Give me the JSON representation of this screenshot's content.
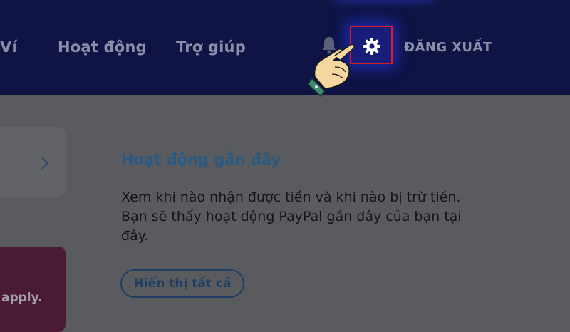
{
  "header": {
    "nav": [
      "Ví",
      "Hoạt động",
      "Trợ giúp"
    ],
    "logout_label": "ĐĂNG XUẤT",
    "icons": {
      "notifications": "bell-icon",
      "settings": "gear-icon",
      "pointer": "pointing-hand-icon"
    },
    "highlight_color": "#e01a22"
  },
  "left_panel": {
    "promo_text": "apply."
  },
  "activity": {
    "title": "Hoạt động gần đây",
    "description": "Xem khi nào nhận được tiền và khi nào bị trừ tiền. Bạn sẽ thấy hoạt động PayPal gần đây của bạn tại đây.",
    "show_all_label": "Hiển thị tất cả"
  }
}
